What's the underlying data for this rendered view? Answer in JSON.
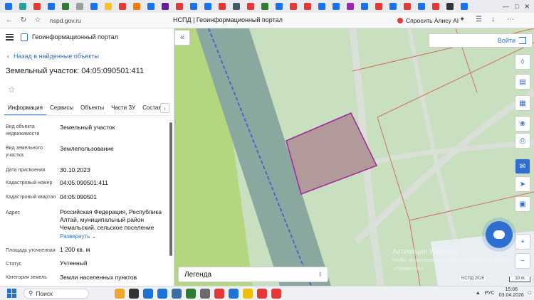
{
  "browser": {
    "url": "nspd.gov.ru",
    "page_title": "НСПД | Геоинформационный портал",
    "alisa_label": "Спросить Алису AI",
    "tab_colors": [
      "#1a73e8",
      "#26a69a",
      "#e53935",
      "#1a73e8",
      "#2e7d32",
      "#9e9e9e",
      "#1a73e8",
      "#fbc02d",
      "#e53935",
      "#f57c00",
      "#1a73e8",
      "#6a1b9a",
      "#e53935",
      "#1a73e8",
      "#1a73e8",
      "#e53935",
      "#455a64",
      "#e53935",
      "#2e7d32",
      "#1a73e8",
      "#e53935",
      "#e53935",
      "#1a73e8",
      "#1a73e8",
      "#9c27b0",
      "#1a73e8",
      "#e53935",
      "#1a73e8",
      "#e53935",
      "#1a73e8",
      "#e53935",
      "#333333",
      "#1a73e8"
    ]
  },
  "sidebar": {
    "portal_name": "Геоинформационный портал",
    "back_label": "Назад в найденные объекты",
    "title": "Земельный участок: 04:05:090501:411",
    "tabs": [
      {
        "label": "Информация",
        "active": true
      },
      {
        "label": "Сервисы",
        "active": false
      },
      {
        "label": "Объекты",
        "active": false
      },
      {
        "label": "Части ЗУ",
        "active": false
      },
      {
        "label": "Состав",
        "active": false
      }
    ],
    "properties": [
      {
        "label": "Вид объекта недвижимости",
        "value": "Земельный участок"
      },
      {
        "label": "Вид земельного участка",
        "value": "Землепользование"
      },
      {
        "label": "Дата присвоения",
        "value": "30.10.2023"
      },
      {
        "label": "Кадастровый номер",
        "value": "04:05:090501:411"
      },
      {
        "label": "Кадастровый квартал",
        "value": "04:05:090501"
      },
      {
        "label": "Адрес",
        "value": "Российская Федерация, Республика Алтай, муниципальный район Чемальский, сельское поселение"
      },
      {
        "label": "Площадь уточненная",
        "value": "1 200 кв. м"
      },
      {
        "label": "Статус",
        "value": "Учтенный"
      },
      {
        "label": "Категория земель",
        "value": "Земли населенных пунктов"
      }
    ],
    "expand_label": "Развернуть"
  },
  "map": {
    "login_label": "Войти",
    "legend_label": "Легенда",
    "watermark_title": "Активация Windows",
    "watermark_sub": "Чтобы активировать Windows, перейдите в раздел «Параметры».",
    "copyright": "НСПД 2026",
    "scale_label": "10 m",
    "parcel_fill": "#b39a9a",
    "parcel_stroke": "#a0289e",
    "tools": [
      "layers-icon",
      "ruler-icon",
      "grid-icon",
      "share-icon",
      "print-icon",
      "chat-icon",
      "location-icon",
      "minimap-icon",
      "zoom-in-icon",
      "zoom-out-icon"
    ]
  },
  "taskbar": {
    "search_label": "Поиск",
    "lang": "РУС",
    "time": "15:06",
    "date": "03.04.2026",
    "apps": [
      "#f0a830",
      "#333333",
      "#1f73d8",
      "#1f73d8",
      "#3a6ea5",
      "#2e7d32",
      "#6b6b6b",
      "#e53935",
      "#1f73d8",
      "#f0c000",
      "#e53935",
      "#e53935"
    ]
  }
}
